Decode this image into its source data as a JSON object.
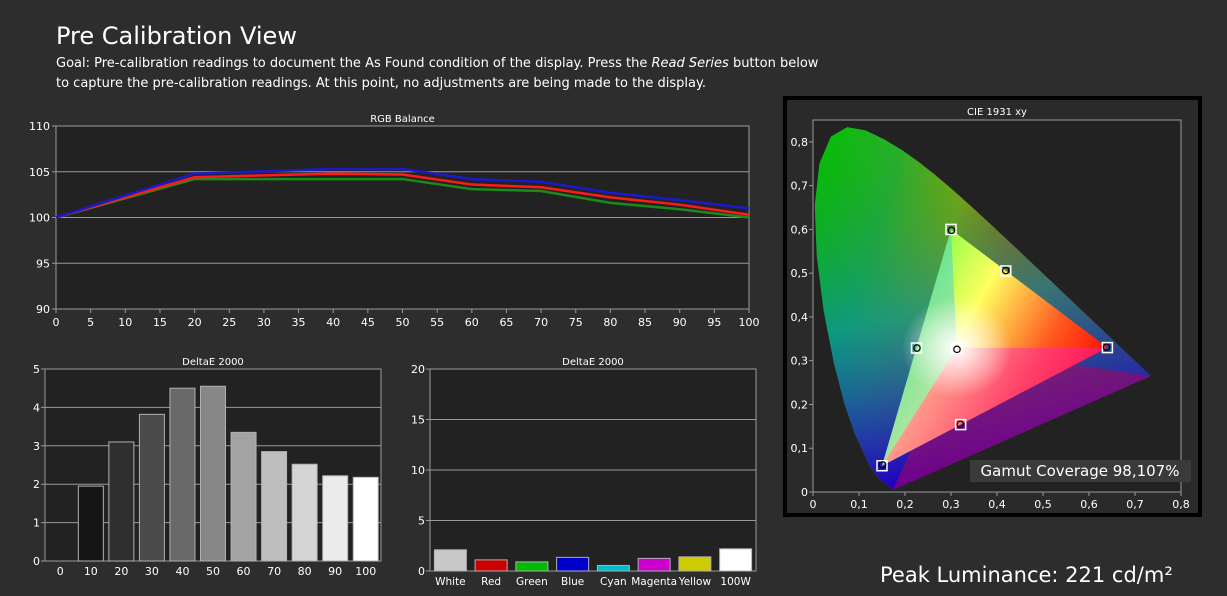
{
  "page": {
    "title": "Pre Calibration View",
    "goal_prefix": "Goal: Pre-calibration readings to document the As Found condition of the display. Press the ",
    "goal_button": "Read Series",
    "goal_suffix": " button below to capture the pre-calibration readings. At this point, no adjustments are being made to the display.",
    "peak_luminance": "Peak Luminance: 221 cd/m²"
  },
  "colors": {
    "background": "#2d2d2d",
    "plot_bg": "#222222",
    "grid": "#9a9a9a",
    "red_line": "#ff1a1a",
    "green_line": "#1a8a1a",
    "blue_line": "#1a1acc"
  },
  "chart_data": [
    {
      "id": "rgb",
      "type": "line",
      "title": "RGB Balance",
      "x": [
        0,
        20,
        40,
        50,
        60,
        70,
        80,
        90,
        100
      ],
      "xticks": [
        "0",
        "5",
        "10",
        "15",
        "20",
        "25",
        "30",
        "35",
        "40",
        "45",
        "50",
        "55",
        "60",
        "65",
        "70",
        "75",
        "80",
        "85",
        "90",
        "95",
        "100"
      ],
      "yticks": [
        "90",
        "95",
        "100",
        "105",
        "110"
      ],
      "xlim": [
        0,
        100
      ],
      "ylim": [
        90,
        110
      ],
      "grid": true,
      "series": [
        {
          "color": "#1a8a1a",
          "values": [
            100,
            104.2,
            104.2,
            104.2,
            103.1,
            102.9,
            101.6,
            100.9,
            100.0
          ]
        },
        {
          "color": "#ff1a1a",
          "values": [
            100,
            104.4,
            104.8,
            104.7,
            103.6,
            103.3,
            102.2,
            101.4,
            100.3
          ]
        },
        {
          "color": "#1a1acc",
          "values": [
            100,
            104.8,
            105.3,
            105.3,
            104.2,
            103.9,
            102.7,
            101.9,
            101.0
          ]
        }
      ]
    },
    {
      "id": "de1",
      "type": "bar",
      "title": "DeltaE 2000",
      "categories": [
        "0",
        "10",
        "20",
        "30",
        "40",
        "50",
        "60",
        "70",
        "80",
        "90",
        "100"
      ],
      "values": [
        0,
        1.95,
        3.1,
        3.82,
        4.5,
        4.55,
        3.35,
        2.85,
        2.52,
        2.22,
        2.18
      ],
      "bar_colors": [
        "#000000",
        "#151515",
        "#2f2f2f",
        "#4b4b4b",
        "#696969",
        "#878787",
        "#a3a3a3",
        "#bdbdbd",
        "#d5d5d5",
        "#ebebeb",
        "#ffffff"
      ],
      "yticks": [
        "0",
        "1",
        "2",
        "3",
        "4",
        "5"
      ],
      "ylim": [
        0,
        5
      ],
      "grid": true
    },
    {
      "id": "de2",
      "type": "bar",
      "title": "DeltaE 2000",
      "categories": [
        "White",
        "Red",
        "Green",
        "Blue",
        "Cyan",
        "Magenta",
        "Yellow",
        "100W"
      ],
      "values": [
        2.1,
        1.1,
        0.9,
        1.35,
        0.55,
        1.25,
        1.4,
        2.2
      ],
      "bar_colors": [
        "#c8c8c8",
        "#cc0000",
        "#00bb00",
        "#0000cc",
        "#00bbcc",
        "#cc00cc",
        "#cccc00",
        "#ffffff"
      ],
      "yticks": [
        "0",
        "5",
        "10",
        "15",
        "20"
      ],
      "ylim": [
        0,
        20
      ],
      "grid": true
    },
    {
      "id": "cie",
      "type": "scatter",
      "title": "CIE 1931 xy",
      "xticks": [
        "0",
        "0,1",
        "0,2",
        "0,3",
        "0,4",
        "0,5",
        "0,6",
        "0,7",
        "0,8"
      ],
      "yticks": [
        "0",
        "0,1",
        "0,2",
        "0,3",
        "0,4",
        "0,5",
        "0,6",
        "0,7",
        "0,8"
      ],
      "xlim": [
        0,
        0.8
      ],
      "ylim": [
        0,
        0.85
      ],
      "gamut_coverage": "Gamut Coverage 98,107%",
      "targets": [
        {
          "x": 0.64,
          "y": 0.33
        },
        {
          "x": 0.3,
          "y": 0.6
        },
        {
          "x": 0.15,
          "y": 0.06
        },
        {
          "x": 0.225,
          "y": 0.329
        },
        {
          "x": 0.321,
          "y": 0.154
        },
        {
          "x": 0.419,
          "y": 0.505
        },
        {
          "x": 0.3127,
          "y": 0.329
        }
      ],
      "measured": [
        {
          "x": 0.638,
          "y": 0.331
        },
        {
          "x": 0.301,
          "y": 0.598
        },
        {
          "x": 0.151,
          "y": 0.062
        },
        {
          "x": 0.226,
          "y": 0.329
        },
        {
          "x": 0.32,
          "y": 0.155
        },
        {
          "x": 0.419,
          "y": 0.506
        },
        {
          "x": 0.313,
          "y": 0.326
        }
      ]
    }
  ]
}
